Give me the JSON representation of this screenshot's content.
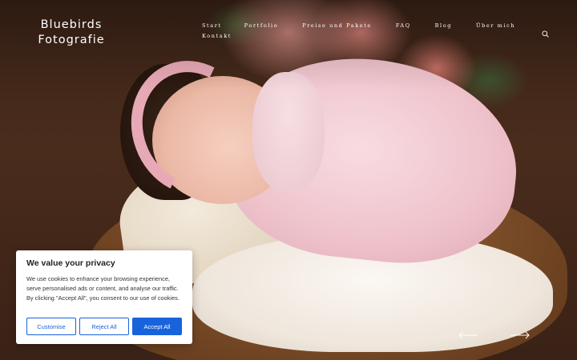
{
  "brand": {
    "line1": "Bluebirds",
    "line2": "Fotografie"
  },
  "nav": {
    "items": [
      {
        "label": "Start"
      },
      {
        "label": "Portfolio"
      },
      {
        "label": "Preise und Pakete"
      },
      {
        "label": "FAQ"
      },
      {
        "label": "Blog"
      },
      {
        "label": "Über mich"
      },
      {
        "label": "Kontakt"
      }
    ],
    "search_icon": "search-icon"
  },
  "slider": {
    "prev_icon": "arrow-left-icon",
    "next_icon": "arrow-right-icon"
  },
  "cookie_banner": {
    "title": "We value your privacy",
    "body": "We use cookies to enhance your browsing experience, serve personalised ads or content, and analyse our traffic. By clicking \"Accept All\", you consent to our use of cookies.",
    "customise_label": "Customise",
    "reject_label": "Reject All",
    "accept_label": "Accept All",
    "accent_color": "#1863dc"
  }
}
